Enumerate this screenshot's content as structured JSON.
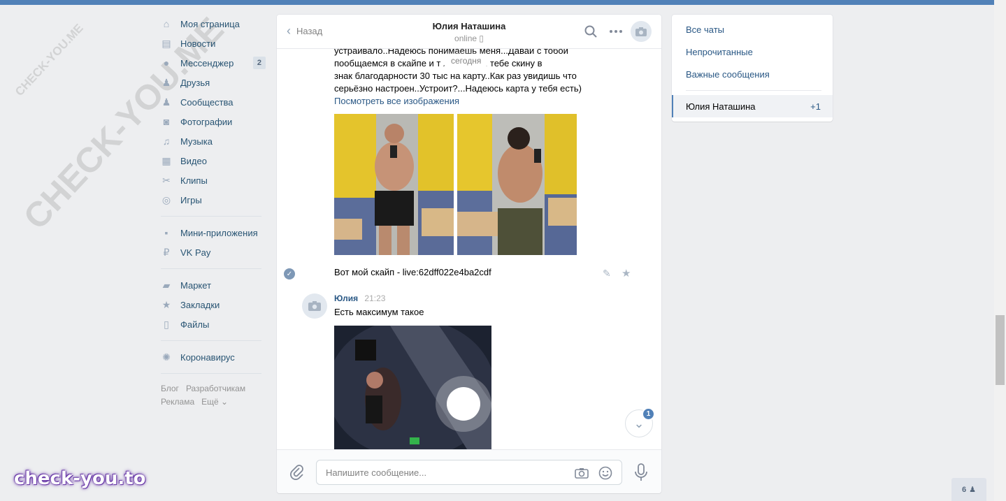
{
  "nav": {
    "items": [
      {
        "label": "Моя страница",
        "icon": "home-icon",
        "glyph": "⌂"
      },
      {
        "label": "Новости",
        "icon": "news-icon",
        "glyph": "▤"
      },
      {
        "label": "Мессенджер",
        "icon": "messenger-icon",
        "glyph": "●",
        "badge": "2"
      },
      {
        "label": "Друзья",
        "icon": "friends-icon",
        "glyph": "♟"
      },
      {
        "label": "Сообщества",
        "icon": "communities-icon",
        "glyph": "♟"
      },
      {
        "label": "Фотографии",
        "icon": "camera-icon",
        "glyph": "◙"
      },
      {
        "label": "Музыка",
        "icon": "music-icon",
        "glyph": "♫"
      },
      {
        "label": "Видео",
        "icon": "video-icon",
        "glyph": "▦"
      },
      {
        "label": "Клипы",
        "icon": "clips-icon",
        "glyph": "✂"
      },
      {
        "label": "Игры",
        "icon": "games-icon",
        "glyph": "◎"
      }
    ],
    "items2": [
      {
        "label": "Мини-приложения",
        "icon": "apps-icon",
        "glyph": "▪"
      },
      {
        "label": "VK Pay",
        "icon": "vkpay-icon",
        "glyph": "₽"
      }
    ],
    "items3": [
      {
        "label": "Маркет",
        "icon": "market-icon",
        "glyph": "▰"
      },
      {
        "label": "Закладки",
        "icon": "bookmark-star-icon",
        "glyph": "★"
      },
      {
        "label": "Файлы",
        "icon": "file-icon",
        "glyph": "▯"
      }
    ],
    "items4": [
      {
        "label": "Коронавирус",
        "icon": "virus-icon",
        "glyph": "✺"
      }
    ],
    "footer": [
      "Блог",
      "Разработчикам",
      "Реклама",
      "Ещё ⌄"
    ]
  },
  "chat": {
    "back_label": "Назад",
    "peer_name": "Юлия Наташина",
    "peer_status": "online ▯",
    "date_pill": "сегодня",
    "msg_top_line1": "устраивало..Надеюсь понимаешь меня...Давай с тобой",
    "msg_top_line2": "пообщаемся в скайпе и т                  жешь...А я тебе скину в",
    "msg_top_line3": "знак благодарности 30 тыс на карту..Как раз увидишь что",
    "msg_top_line4": "серьёзно настроен..Устроит?...Надеюсь карта у тебя есть)",
    "view_all_images": "Посмотреть все изображения",
    "skype_msg": "Вот мой скайп - live:62dff022e4ba2cdf",
    "sender_name": "Юлия",
    "sender_time": "21:23",
    "reply_text": "Есть максимум такое",
    "input_placeholder": "Напишите сообщение...",
    "scroll_badge": "1"
  },
  "right_panel": {
    "all_chats": "Все чаты",
    "unread": "Непрочитанные",
    "important": "Важные сообщения",
    "active_name": "Юлия Наташина",
    "active_count": "+1"
  },
  "watermarks": {
    "small": "CHECK-YOU.ME",
    "large": "CHECK-YOU.ME",
    "brand": "check-you.to"
  },
  "online_count": "6",
  "colors": {
    "accent": "#5181b8",
    "link": "#2a5885",
    "nav_link": "#285473",
    "background": "#edeef0"
  }
}
